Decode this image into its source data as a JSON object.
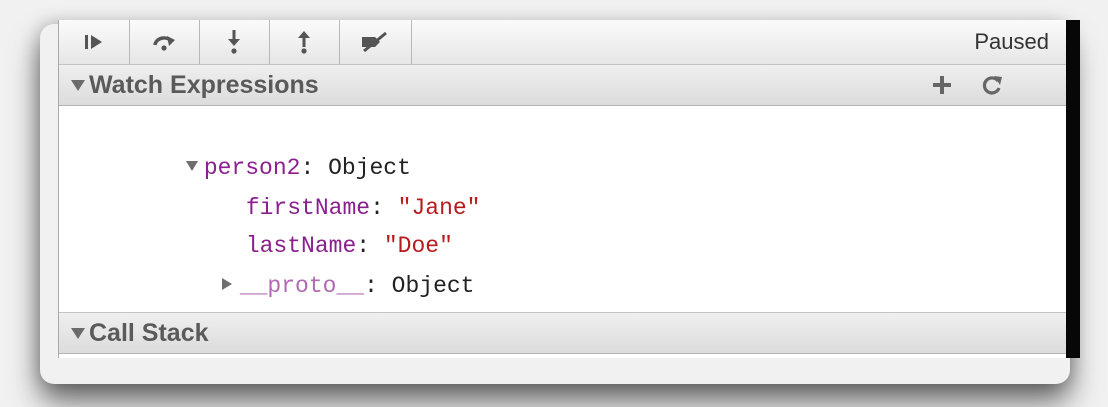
{
  "toolbar": {
    "buttons": [
      {
        "icon": "resume-icon"
      },
      {
        "icon": "step-over-icon"
      },
      {
        "icon": "step-into-icon"
      },
      {
        "icon": "step-out-icon"
      },
      {
        "icon": "deactivate-breakpoints-icon"
      }
    ],
    "status": "Paused"
  },
  "watch": {
    "title": "Watch Expressions",
    "add_icon": "plus-icon",
    "refresh_icon": "refresh-icon",
    "tree": {
      "root_key": "person2",
      "root_value": "Object",
      "props": [
        {
          "key": "firstName",
          "value": "\"Jane\""
        },
        {
          "key": "lastName",
          "value": "\"Doe\""
        }
      ],
      "proto_key": "__proto__",
      "proto_value": "Object"
    }
  },
  "call_stack": {
    "title": "Call Stack"
  },
  "colors": {
    "property_name": "#8a1f8e",
    "string_value": "#b81b1b",
    "header_text": "#5a5a5a"
  }
}
